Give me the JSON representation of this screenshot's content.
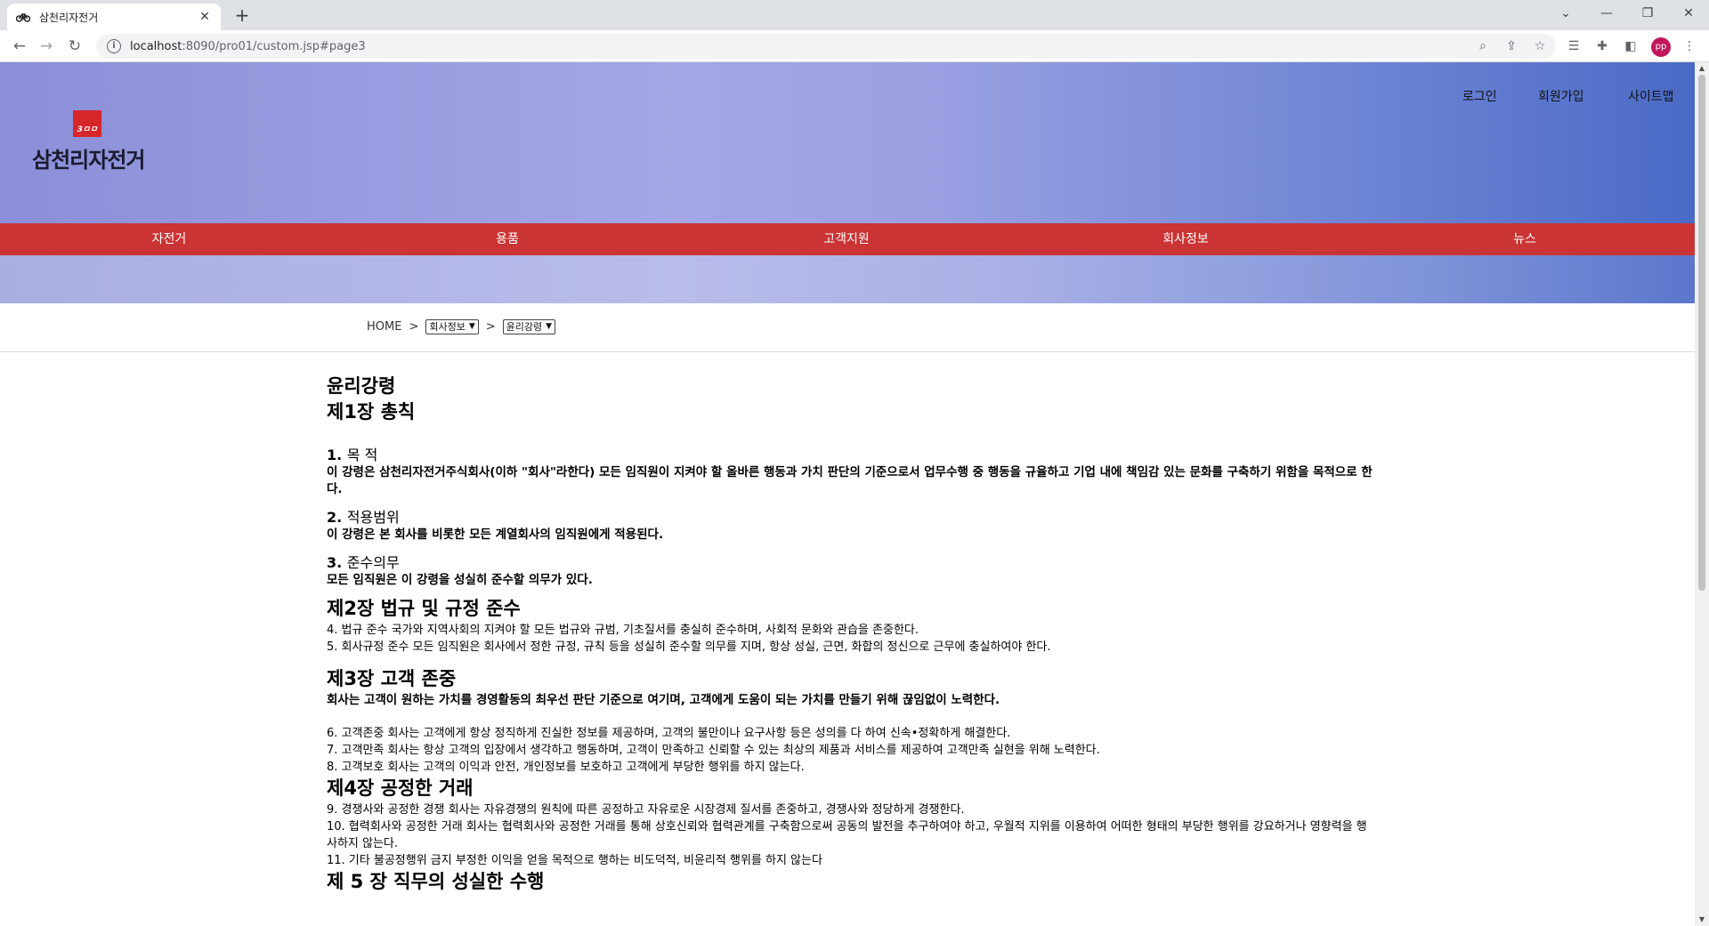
{
  "browser": {
    "tab_title": "삼천리자전거",
    "url_host": "localhost",
    "url_path": ":8090/pro01/custom.jsp#page3",
    "profile_initials": "pp"
  },
  "header": {
    "logo_mark": "3ㅁㅁ",
    "logo_text": "삼천리자전거",
    "util_links": [
      "로그인",
      "회원가입",
      "사이트맵"
    ]
  },
  "gnb": [
    "자전거",
    "용품",
    "고객지원",
    "회사정보",
    "뉴스"
  ],
  "breadcrumb": {
    "home": "HOME",
    "sep": ">",
    "select1": "회사정보",
    "select2": "윤리강령"
  },
  "content": {
    "title": "윤리강령",
    "ch1": "제1장 총칙",
    "s1_num": "1.",
    "s1_title": "목 적",
    "s1_body": "이 강령은 삼천리자전거주식회사(이하 \"회사\"라한다) 모든 임직원이 지켜야 할 올바른 행동과 가치 판단의 기준으로서 업무수행 중 행동을 규율하고 기업 내에 책임감 있는 문화를 구축하기 위함을 목적으로 한다.",
    "s2_num": "2.",
    "s2_title": "적용범위",
    "s2_body": "이 강령은 본 회사를 비롯한 모든 계열회사의 임직원에게 적용된다.",
    "s3_num": "3.",
    "s3_title": "준수의무",
    "s3_body": "모든 임직원은 이 강령을 성실히 준수할 의무가 있다.",
    "ch2": "제2장 법규 및 규정 준수",
    "ch2_items": [
      "4. 법규 준수 국가와 지역사회의 지켜야 할 모든 법규와 규범, 기초질서를 충실히 준수하며, 사회적 문화와 관습을 존중한다.",
      "5. 회사규정 준수 모든 임직원은 회사에서 정한 규정, 규칙 등을 성실히 준수할 의무를 지며, 항상 성실, 근면, 화합의 정신으로 근무에 충실하여야 한다."
    ],
    "ch3": "제3장 고객 존중",
    "ch3_lead": "회사는 고객이 원하는 가치를 경영활동의 최우선 판단 기준으로 여기며, 고객에게 도움이 되는 가치를 만들기 위해 끊임없이 노력한다.",
    "ch3_items": [
      "6. 고객존중 회사는 고객에게 항상 정직하게 진실한 정보를 제공하며, 고객의 불만이나 요구사항 등은 성의를 다 하여 신속•정확하게 해결한다.",
      "7. 고객만족 회사는 항상 고객의 입장에서 생각하고 행동하며, 고객이 만족하고 신뢰할 수 있는 최상의 제품과 서비스를 제공하여 고객만족 실현을 위해 노력한다.",
      "8. 고객보호 회사는 고객의 이익과 안전, 개인정보를 보호하고 고객에게 부당한 행위를 하지 않는다."
    ],
    "ch4": "제4장 공정한 거래",
    "ch4_items": [
      "9. 경쟁사와 공정한 경쟁 회사는 자유경쟁의 원칙에 따른 공정하고 자유로운 시장경제 질서를 존중하고, 경쟁사와 정당하게 경쟁한다.",
      "10. 협력회사와 공정한 거래 회사는 협력회사와 공정한 거래를 통해 상호신뢰와 협력관계를 구축함으로써 공동의 발전을 추구하여야 하고, 우월적 지위를 이용하여 어떠한 형태의 부당한 행위를 강요하거나 영향력을 행사하지 않는다.",
      "11. 기타 불공정행위 금지 부정한 이익을 얻을 목적으로 행하는 비도덕적, 비윤리적 행위를 하지 않는다"
    ],
    "ch5": "제 5 장 직무의 성실한 수행"
  }
}
